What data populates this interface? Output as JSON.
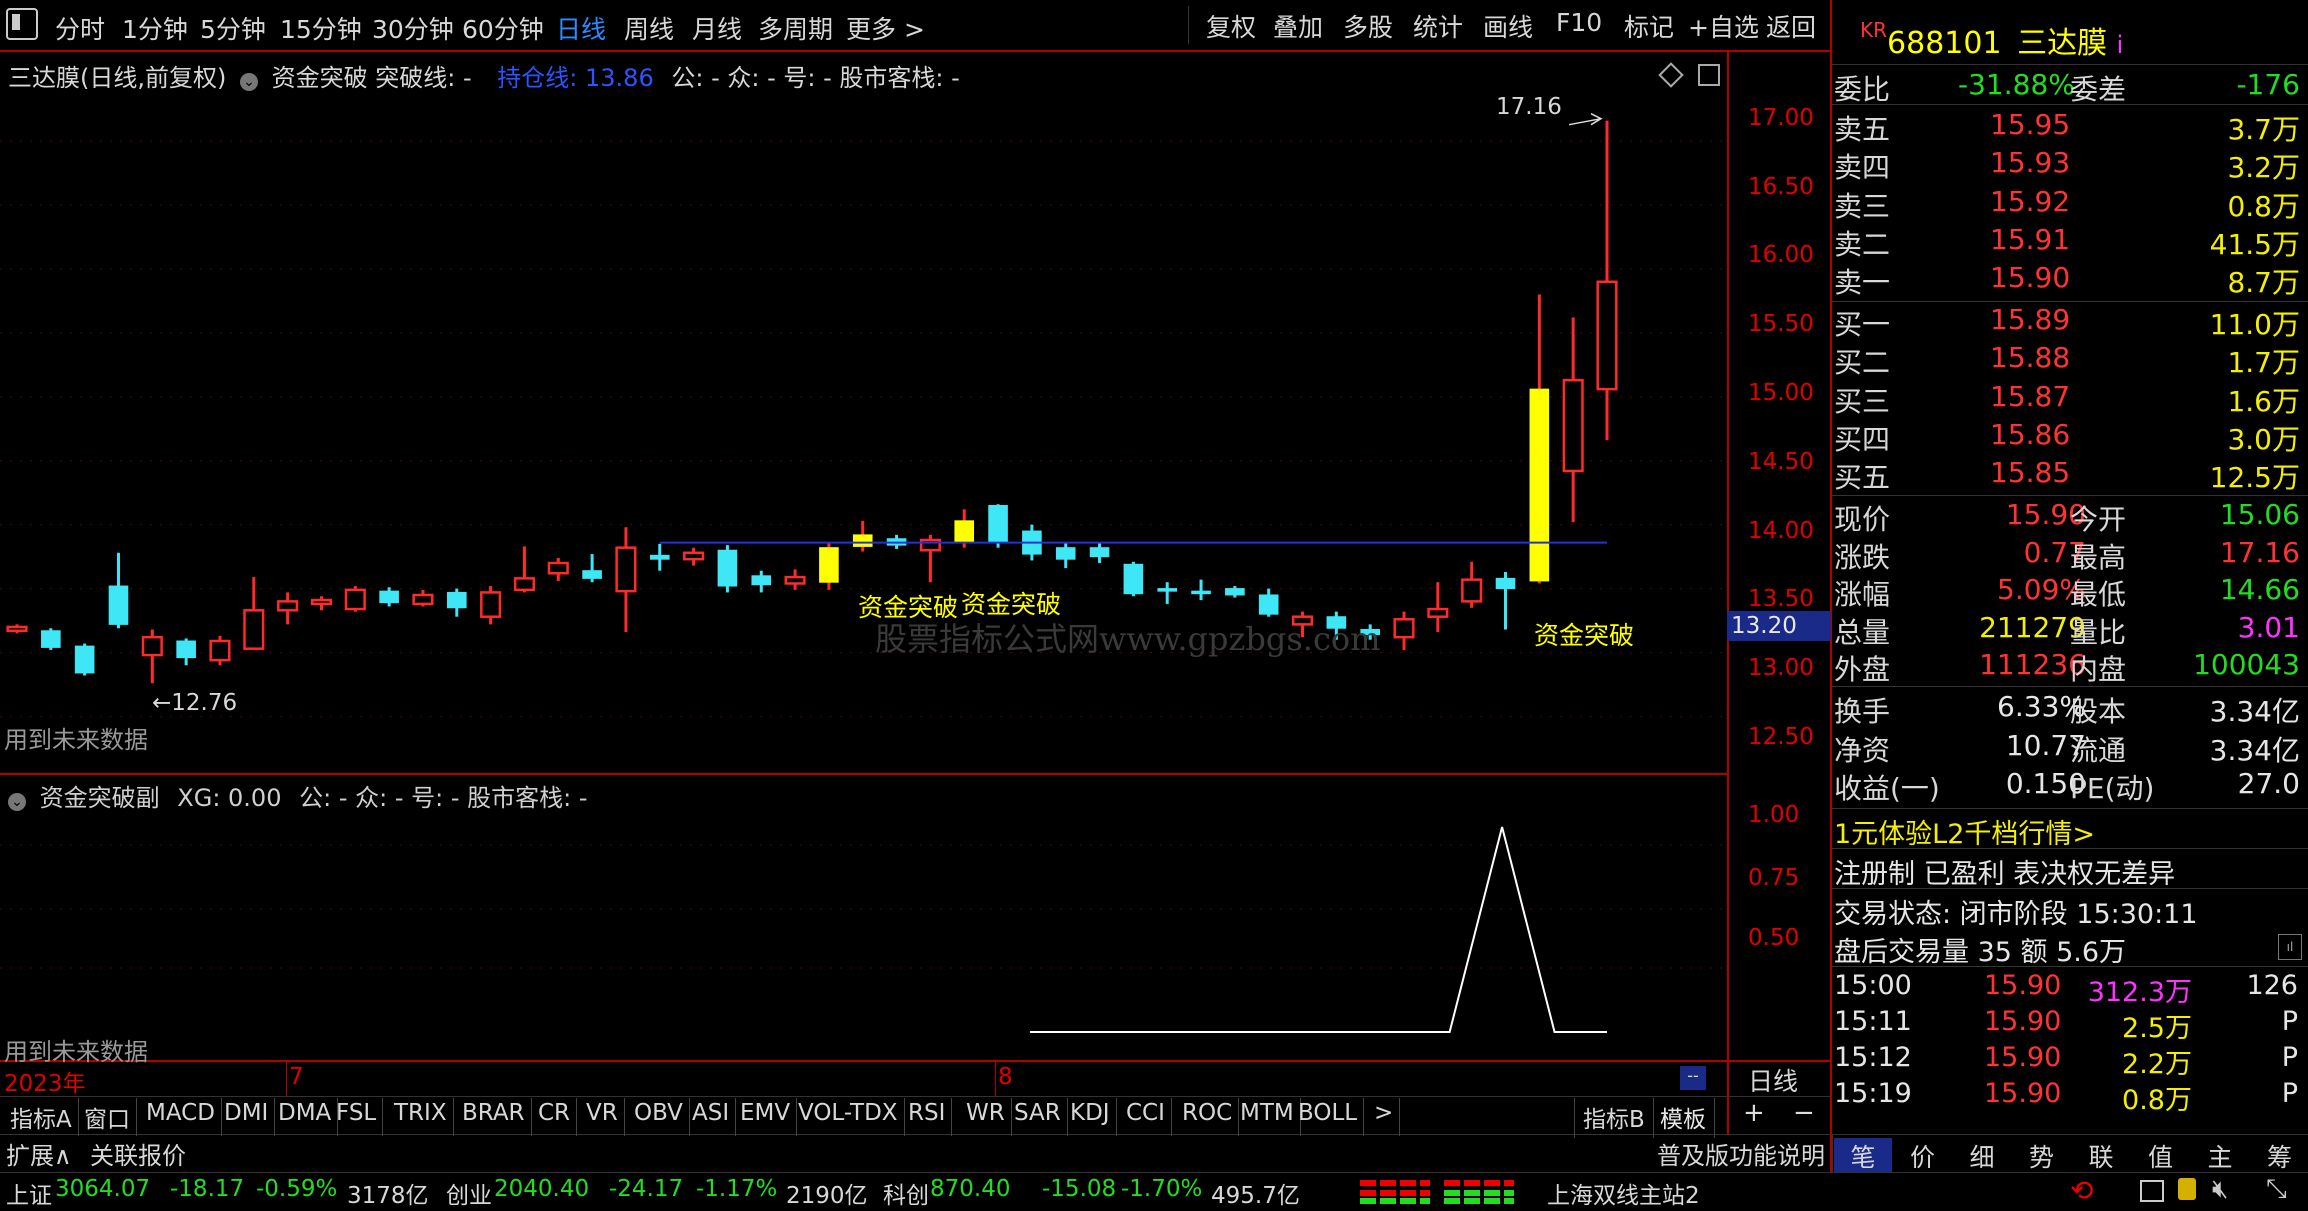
{
  "top_tabs": [
    "分时",
    "1分钟",
    "5分钟",
    "15分钟",
    "30分钟",
    "60分钟",
    "日线",
    "周线",
    "月线",
    "多周期",
    "更多 >"
  ],
  "top_right_buttons": [
    "复权",
    "叠加",
    "多股",
    "统计",
    "画线",
    "F10",
    "标记",
    "+自选",
    "返回"
  ],
  "chart_header": {
    "name": "三达膜(日线,前复权)",
    "ind": "资金突破 突破线: -",
    "hold_label": "持仓线: 13.86",
    "rest": "公: -  众: -  号: -  股市客栈: -"
  },
  "watermark": "股票指标公式网www.gpzbgs.com",
  "future_text": "用到未来数据",
  "low_mark": "←12.76",
  "high_mark": "17.16",
  "signal_label": "资金突破",
  "price_axis": [
    "17.00",
    "16.50",
    "16.00",
    "15.50",
    "15.00",
    "14.50",
    "14.00",
    "13.50",
    "13.00",
    "12.50"
  ],
  "current_price_tag": "13.20",
  "sub_header": {
    "name": "资金突破副",
    "xg": "XG: 0.00",
    "rest": "公: -  众: -  号: -  股市客栈: -"
  },
  "sub_axis": [
    "1.00",
    "0.75",
    "0.50"
  ],
  "time_axis": {
    "year": "2023年",
    "m7": "7",
    "m8": "8",
    "period": "日线"
  },
  "indicators": [
    "指标A",
    "窗口",
    "MACD",
    "DMI",
    "DMA",
    "FSL",
    "TRIX",
    "BRAR",
    "CR",
    "VR",
    "OBV",
    "ASI",
    "EMV",
    "VOL-TDX",
    "RSI",
    "WR",
    "SAR",
    "KDJ",
    "CCI",
    "ROC",
    "MTM",
    "BOLL",
    ">"
  ],
  "ind_right": {
    "b": "指标B",
    "tpl": "模板"
  },
  "bottom_left": {
    "expand": "扩展∧",
    "related": "关联报价"
  },
  "stock": {
    "prefix": "KR",
    "code": "688101",
    "name": "三达膜",
    "info": "i"
  },
  "wb": {
    "l1": "委比",
    "v1": "-31.88%",
    "l2": "委差",
    "v2": "-176"
  },
  "asks": [
    {
      "label": "卖五",
      "price": "15.95",
      "vol": "3.7万"
    },
    {
      "label": "卖四",
      "price": "15.93",
      "vol": "3.2万"
    },
    {
      "label": "卖三",
      "price": "15.92",
      "vol": "0.8万"
    },
    {
      "label": "卖二",
      "price": "15.91",
      "vol": "41.5万"
    },
    {
      "label": "卖一",
      "price": "15.90",
      "vol": "8.7万"
    }
  ],
  "bids": [
    {
      "label": "买一",
      "price": "15.89",
      "vol": "11.0万"
    },
    {
      "label": "买二",
      "price": "15.88",
      "vol": "1.7万"
    },
    {
      "label": "买三",
      "price": "15.87",
      "vol": "1.6万"
    },
    {
      "label": "买四",
      "price": "15.86",
      "vol": "3.0万"
    },
    {
      "label": "买五",
      "price": "15.85",
      "vol": "12.5万"
    }
  ],
  "quote": [
    {
      "l1": "现价",
      "v1": "15.90",
      "l2": "今开",
      "v2": "15.06"
    },
    {
      "l1": "涨跌",
      "v1": "0.77",
      "l2": "最高",
      "v2": "17.16"
    },
    {
      "l1": "涨幅",
      "v1": "5.09%",
      "l2": "最低",
      "v2": "14.66"
    },
    {
      "l1": "总量",
      "v1": "211279",
      "l2": "量比",
      "v2": "3.01"
    },
    {
      "l1": "外盘",
      "v1": "111236",
      "l2": "内盘",
      "v2": "100043"
    },
    {
      "l1": "换手",
      "v1": "6.33%",
      "l2": "股本",
      "v2": "3.34亿"
    },
    {
      "l1": "净资",
      "v1": "10.77",
      "l2": "流通",
      "v2": "3.34亿"
    },
    {
      "l1": "收益(一)",
      "v1": "0.150",
      "l2": "PE(动)",
      "v2": "27.0"
    }
  ],
  "promo": "1元体验L2千档行情>",
  "reg_info": "注册制 已盈利 表决权无差异",
  "trade_status": "交易状态: 闭市阶段 15:30:11",
  "after_hours": "盘后交易量 35 额 5.6万",
  "ticks": [
    {
      "time": "15:00",
      "price": "15.90",
      "vol": "312.3万",
      "n": "126"
    },
    {
      "time": "15:11",
      "price": "15.90",
      "vol": "2.5万",
      "n": "P"
    },
    {
      "time": "15:12",
      "price": "15.90",
      "vol": "2.2万",
      "n": "P"
    },
    {
      "time": "15:19",
      "price": "15.90",
      "vol": "0.8万",
      "n": "P"
    }
  ],
  "right_tabs": [
    "笔",
    "价",
    "细",
    "势",
    "联",
    "值",
    "主",
    "筹"
  ],
  "right_bottom_link": "普及版功能说明",
  "status_bar": {
    "sh_label": "上证",
    "sh_val": "3064.07",
    "sh_chg": "-18.17",
    "sh_pct": "-0.59%",
    "sh_amt": "3178亿",
    "cy_label": "创业",
    "cy_val": "2040.40",
    "cy_chg": "-24.17",
    "cy_pct": "-1.17%",
    "cy_amt": "2190亿",
    "kc_label": "科创",
    "kc_val": "870.40",
    "kc_chg": "-15.08",
    "kc_pct": "-1.70%",
    "kc_amt": "495.7亿",
    "server": "上海双线主站2"
  },
  "colors": {
    "up": "#ff2a2a",
    "down": "#3fe6f6",
    "signal": "#ffff00",
    "hold_line": "#2233dd",
    "bg": "#000000"
  },
  "chart_data": {
    "type": "candlestick",
    "ylim": [
      12.3,
      17.4
    ],
    "candles": [
      {
        "o": 13.17,
        "c": 13.2,
        "h": 13.22,
        "l": 13.15,
        "up": true
      },
      {
        "o": 13.17,
        "c": 13.04,
        "h": 13.19,
        "l": 13.02,
        "up": false
      },
      {
        "o": 13.05,
        "c": 12.84,
        "h": 13.07,
        "l": 12.82,
        "up": false
      },
      {
        "o": 13.52,
        "c": 13.22,
        "h": 13.78,
        "l": 13.19,
        "up": false
      },
      {
        "o": 12.98,
        "c": 13.12,
        "h": 13.18,
        "l": 12.76,
        "up": true
      },
      {
        "o": 13.09,
        "c": 12.96,
        "h": 13.11,
        "l": 12.9,
        "up": false
      },
      {
        "o": 12.94,
        "c": 13.09,
        "h": 13.13,
        "l": 12.9,
        "up": true
      },
      {
        "o": 13.03,
        "c": 13.33,
        "h": 13.59,
        "l": 13.03,
        "up": true
      },
      {
        "o": 13.33,
        "c": 13.4,
        "h": 13.47,
        "l": 13.22,
        "up": true
      },
      {
        "o": 13.38,
        "c": 13.41,
        "h": 13.44,
        "l": 13.33,
        "up": true
      },
      {
        "o": 13.34,
        "c": 13.49,
        "h": 13.52,
        "l": 13.32,
        "up": true
      },
      {
        "o": 13.48,
        "c": 13.39,
        "h": 13.51,
        "l": 13.36,
        "up": false
      },
      {
        "o": 13.38,
        "c": 13.45,
        "h": 13.49,
        "l": 13.36,
        "up": true
      },
      {
        "o": 13.47,
        "c": 13.35,
        "h": 13.5,
        "l": 13.28,
        "up": false
      },
      {
        "o": 13.28,
        "c": 13.47,
        "h": 13.52,
        "l": 13.22,
        "up": true
      },
      {
        "o": 13.49,
        "c": 13.58,
        "h": 13.83,
        "l": 13.47,
        "up": true
      },
      {
        "o": 13.62,
        "c": 13.7,
        "h": 13.74,
        "l": 13.56,
        "up": true
      },
      {
        "o": 13.64,
        "c": 13.58,
        "h": 13.77,
        "l": 13.55,
        "up": false
      },
      {
        "o": 13.48,
        "c": 13.82,
        "h": 13.98,
        "l": 13.16,
        "up": true
      },
      {
        "o": 13.76,
        "c": 13.73,
        "h": 13.85,
        "l": 13.64,
        "up": false
      },
      {
        "o": 13.73,
        "c": 13.78,
        "h": 13.82,
        "l": 13.68,
        "up": true
      },
      {
        "o": 13.8,
        "c": 13.52,
        "h": 13.84,
        "l": 13.47,
        "up": false
      },
      {
        "o": 13.6,
        "c": 13.53,
        "h": 13.64,
        "l": 13.47,
        "up": false
      },
      {
        "o": 13.54,
        "c": 13.59,
        "h": 13.65,
        "l": 13.49,
        "up": true
      },
      {
        "o": 13.55,
        "c": 13.82,
        "h": 13.86,
        "l": 13.49,
        "up": true,
        "sig": true
      },
      {
        "o": 13.83,
        "c": 13.92,
        "h": 14.03,
        "l": 13.79,
        "up": true,
        "sig": true
      },
      {
        "o": 13.89,
        "c": 13.84,
        "h": 13.92,
        "l": 13.81,
        "up": false
      },
      {
        "o": 13.8,
        "c": 13.88,
        "h": 13.92,
        "l": 13.55,
        "up": true
      },
      {
        "o": 13.86,
        "c": 14.03,
        "h": 14.12,
        "l": 13.82,
        "up": true,
        "sig": true
      },
      {
        "o": 14.15,
        "c": 13.86,
        "h": 14.16,
        "l": 13.82,
        "up": false
      },
      {
        "o": 13.95,
        "c": 13.77,
        "h": 14.0,
        "l": 13.72,
        "up": false
      },
      {
        "o": 13.82,
        "c": 13.73,
        "h": 13.86,
        "l": 13.66,
        "up": false
      },
      {
        "o": 13.82,
        "c": 13.75,
        "h": 13.86,
        "l": 13.7,
        "up": false
      },
      {
        "o": 13.69,
        "c": 13.46,
        "h": 13.71,
        "l": 13.44,
        "up": false
      },
      {
        "o": 13.5,
        "c": 13.48,
        "h": 13.55,
        "l": 13.38,
        "up": false
      },
      {
        "o": 13.48,
        "c": 13.46,
        "h": 13.57,
        "l": 13.41,
        "up": false
      },
      {
        "o": 13.5,
        "c": 13.45,
        "h": 13.52,
        "l": 13.43,
        "up": false
      },
      {
        "o": 13.45,
        "c": 13.3,
        "h": 13.5,
        "l": 13.28,
        "up": false
      },
      {
        "o": 13.22,
        "c": 13.28,
        "h": 13.32,
        "l": 13.12,
        "up": true
      },
      {
        "o": 13.28,
        "c": 13.19,
        "h": 13.32,
        "l": 13.1,
        "up": false
      },
      {
        "o": 13.18,
        "c": 13.14,
        "h": 13.22,
        "l": 13.1,
        "up": false
      },
      {
        "o": 13.12,
        "c": 13.26,
        "h": 13.32,
        "l": 13.02,
        "up": true
      },
      {
        "o": 13.28,
        "c": 13.34,
        "h": 13.55,
        "l": 13.16,
        "up": true
      },
      {
        "o": 13.4,
        "c": 13.57,
        "h": 13.71,
        "l": 13.35,
        "up": true
      },
      {
        "o": 13.58,
        "c": 13.5,
        "h": 13.63,
        "l": 13.18,
        "up": false
      },
      {
        "o": 13.56,
        "c": 15.06,
        "h": 15.8,
        "l": 13.54,
        "up": true,
        "sig": true
      },
      {
        "o": 14.42,
        "c": 15.13,
        "h": 15.62,
        "l": 14.02,
        "up": true
      },
      {
        "o": 15.06,
        "c": 15.9,
        "h": 17.16,
        "l": 14.66,
        "up": true
      }
    ],
    "hold_line": {
      "value": 13.86
    },
    "sub_series": {
      "values": [
        0,
        0,
        0,
        0,
        0,
        0,
        0,
        0,
        0,
        1,
        0,
        0
      ]
    }
  }
}
